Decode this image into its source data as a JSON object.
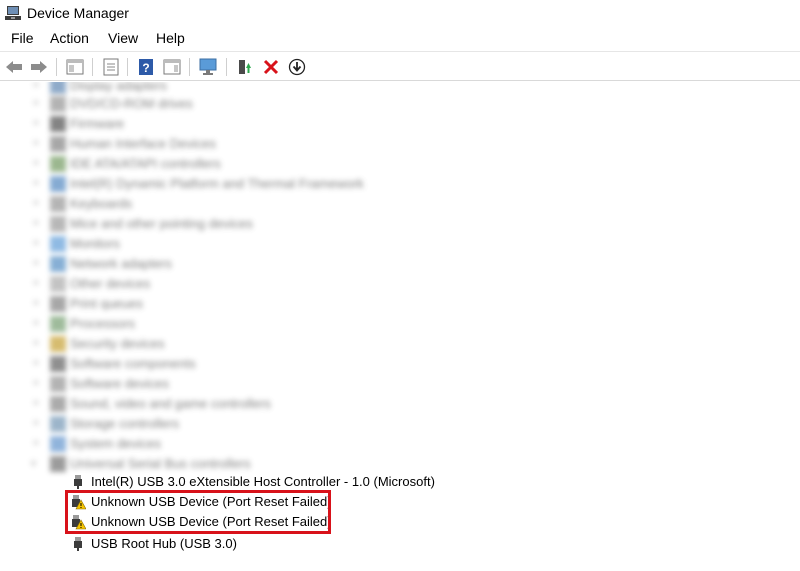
{
  "window": {
    "title": "Device Manager"
  },
  "menu": [
    {
      "id": "file",
      "label": "File"
    },
    {
      "id": "action",
      "label": "Action"
    },
    {
      "id": "view",
      "label": "View"
    },
    {
      "id": "help",
      "label": "Help"
    }
  ],
  "toolbar": {
    "icons": [
      "back-arrow-icon",
      "forward-arrow-icon",
      "show-hide-console-tree-icon",
      "properties-icon",
      "help-icon",
      "action-pane-icon",
      "scan-hardware-changes-icon",
      "update-driver-icon",
      "uninstall-device-icon",
      "enable-device-icon"
    ]
  },
  "tree": {
    "categories": [
      {
        "label": "Display adapters"
      },
      {
        "label": "DVD/CD-ROM drives"
      },
      {
        "label": "Firmware"
      },
      {
        "label": "Human Interface Devices"
      },
      {
        "label": "IDE ATA/ATAPI controllers"
      },
      {
        "label": "Intel(R) Dynamic Platform and Thermal Framework"
      },
      {
        "label": "Keyboards"
      },
      {
        "label": "Mice and other pointing devices"
      },
      {
        "label": "Monitors"
      },
      {
        "label": "Network adapters"
      },
      {
        "label": "Other devices"
      },
      {
        "label": "Print queues"
      },
      {
        "label": "Processors"
      },
      {
        "label": "Security devices"
      },
      {
        "label": "Software components"
      },
      {
        "label": "Software devices"
      },
      {
        "label": "Sound, video and game controllers"
      },
      {
        "label": "Storage controllers"
      },
      {
        "label": "System devices"
      },
      {
        "label": "Universal Serial Bus controllers"
      }
    ],
    "usb_children": [
      {
        "label": "Intel(R) USB 3.0 eXtensible Host Controller - 1.0 (Microsoft)",
        "warning": false
      },
      {
        "label": "Unknown USB Device (Port Reset Failed)",
        "warning": true
      },
      {
        "label": "Unknown USB Device (Port Reset Failed)",
        "warning": true
      },
      {
        "label": "USB Root Hub (USB 3.0)",
        "warning": false
      }
    ]
  },
  "colors": {
    "highlight": "#d8121a",
    "warning": "#f5c400",
    "accent": "#1a6fc9"
  }
}
